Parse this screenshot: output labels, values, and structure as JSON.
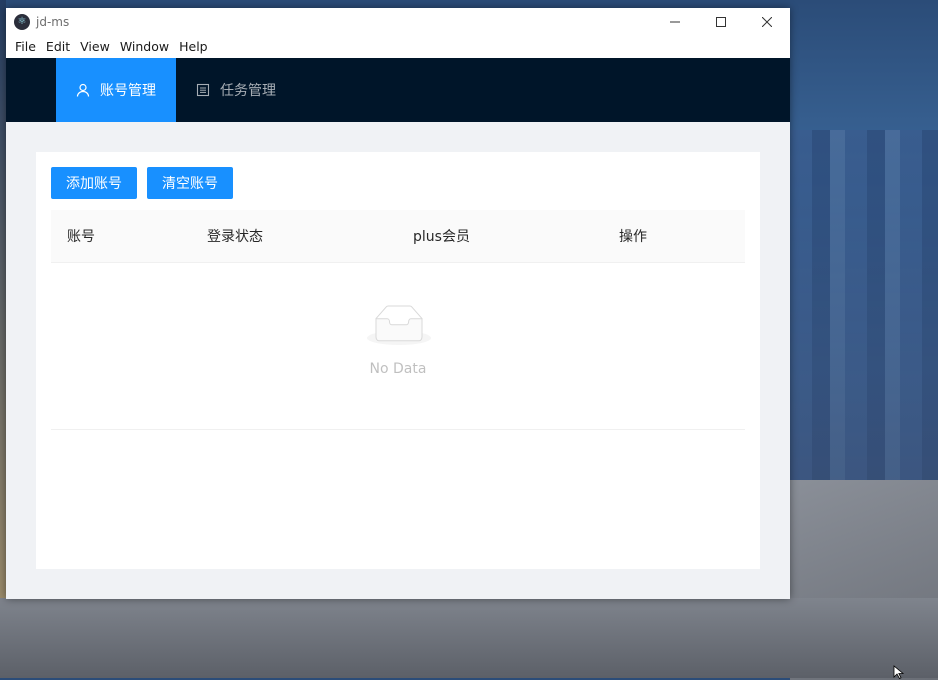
{
  "window": {
    "title": "jd-ms",
    "controls": {
      "minimize": "—",
      "maximize": "☐",
      "close": "✕"
    }
  },
  "menu": [
    "File",
    "Edit",
    "View",
    "Window",
    "Help"
  ],
  "nav": [
    {
      "label": "账号管理",
      "icon": "user-icon",
      "active": true
    },
    {
      "label": "任务管理",
      "icon": "list-icon",
      "active": false
    }
  ],
  "toolbar": {
    "add_label": "添加账号",
    "clear_label": "清空账号"
  },
  "table": {
    "columns": [
      "账号",
      "登录状态",
      "plus会员",
      "操作"
    ],
    "rows": [],
    "empty_text": "No Data"
  },
  "colors": {
    "header_bg": "#001529",
    "accent": "#1890ff",
    "content_bg": "#f0f2f5"
  }
}
